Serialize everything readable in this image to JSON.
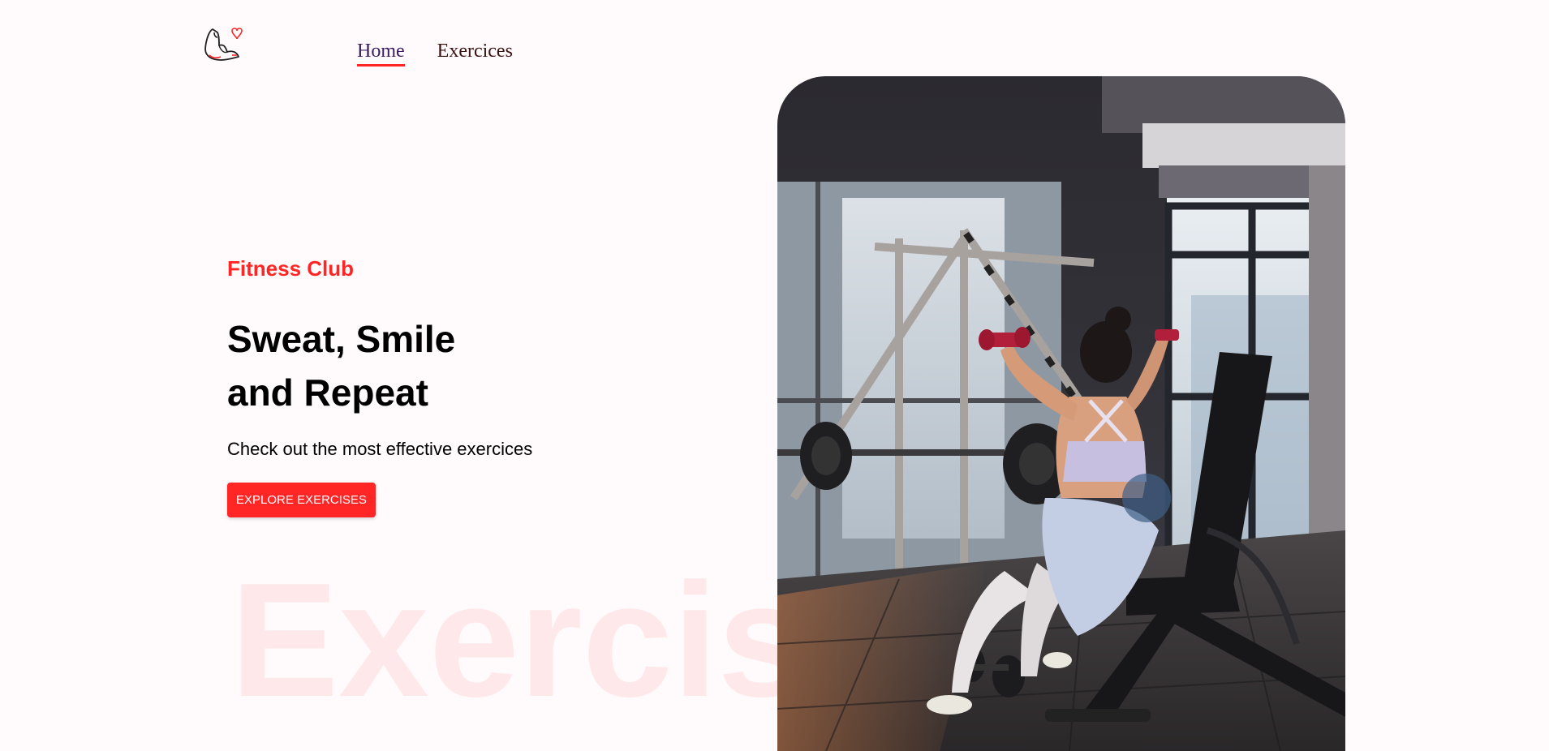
{
  "nav": {
    "links": [
      {
        "label": "Home"
      },
      {
        "label": "Exercices"
      }
    ]
  },
  "hero": {
    "tag": "Fitness Club",
    "headline_line1": "Sweat, Smile",
    "headline_line2": "and Repeat",
    "subtitle": "Check out the most effective exercices",
    "cta_label": "EXPLORE EXERCISES",
    "watermark": "Exercises"
  },
  "colors": {
    "accent": "#ff2625",
    "background": "#fffafb",
    "nav_active": "#3a1e5f"
  },
  "icons": {
    "logo": "flexed-arm-heart-icon"
  }
}
